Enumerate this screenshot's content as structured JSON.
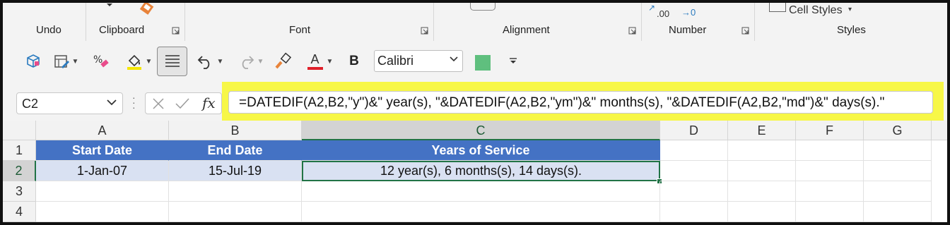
{
  "ribbon": {
    "groups": [
      "Undo",
      "Clipboard",
      "Font",
      "Alignment",
      "Number",
      "Styles"
    ],
    "cell_styles_label": "Cell Styles",
    "number_peek": [
      ".00",
      "→0"
    ]
  },
  "toolbar": {
    "font_name": "Calibri",
    "fill_color": "#5fbf7e",
    "font_color": "#e0202a",
    "highlight_color": "#f5e600",
    "bold_label": "B",
    "font_color_label": "A"
  },
  "formula_bar": {
    "name_box": "C2",
    "fx_label": "fx",
    "formula": "=DATEDIF(A2,B2,\"y\")&\" year(s), \"&DATEDIF(A2,B2,\"ym\")&\" months(s), \"&DATEDIF(A2,B2,\"md\")&\" days(s).\"",
    "highlight_color": "#f7f747"
  },
  "sheet": {
    "columns": [
      "A",
      "B",
      "C",
      "D",
      "E",
      "F",
      "G"
    ],
    "rows": [
      "1",
      "2",
      "3",
      "4"
    ],
    "cells": {
      "A1": "Start Date",
      "B1": "End Date",
      "C1": "Years of Service",
      "A2": "1-Jan-07",
      "B2": "15-Jul-19",
      "C2": "12 year(s), 6 months(s), 14 days(s)."
    },
    "header_fill": "#4472c4",
    "data_fill": "#d9e1f2",
    "selection_color": "#217346"
  }
}
